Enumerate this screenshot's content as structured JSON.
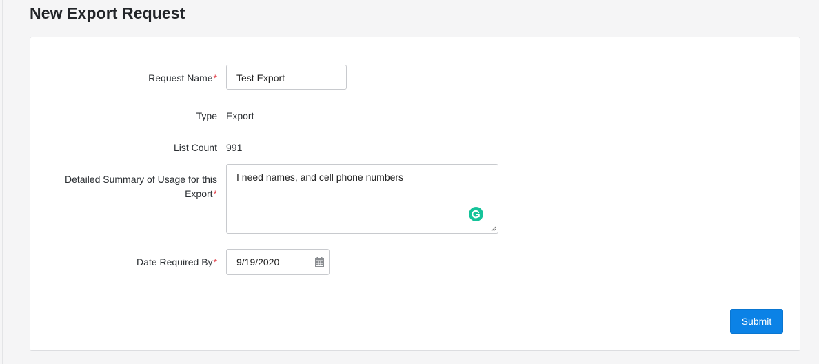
{
  "page": {
    "title": "New Export Request"
  },
  "form": {
    "request_name": {
      "label": "Request Name",
      "required_mark": "*",
      "value": "Test Export"
    },
    "type": {
      "label": "Type",
      "value": "Export"
    },
    "list_count": {
      "label": "List Count",
      "value": "991"
    },
    "summary": {
      "label_line1": "Detailed Summary of Usage for this",
      "label_line2": "Export",
      "required_mark": "*",
      "value": "I need names, and cell phone numbers"
    },
    "date_required": {
      "label": "Date Required By",
      "required_mark": "*",
      "value": "9/19/2020"
    },
    "submit_label": "Submit"
  },
  "icons": {
    "grammarly": "grammarly-icon",
    "calendar": "calendar-icon",
    "resize": "resize-handle-icon"
  },
  "colors": {
    "required": "#e0323c",
    "primary": "#0b82e6",
    "grammarly": "#15c39a"
  }
}
